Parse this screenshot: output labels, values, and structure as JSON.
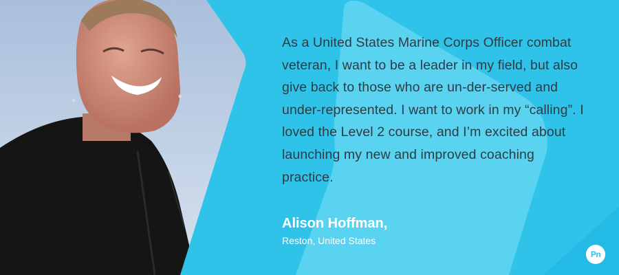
{
  "testimonial": {
    "quote": "As a United States Marine Corps Officer combat veteran, I want to be a leader in my field, but also give back to those who are un-der-served and under-represented. I want to work in my “calling”. I loved the Level 2 course, and I’m excited about launching my new and improved coaching practice.",
    "author_name": "Alison Hoffman,",
    "author_location": "Reston, United States"
  },
  "logo": {
    "text": "Pn"
  },
  "colors": {
    "background": "#2fc3ea",
    "shape_light": "#6ad8f3",
    "text_dark": "#2d3b44",
    "text_light": "#ffffff"
  }
}
